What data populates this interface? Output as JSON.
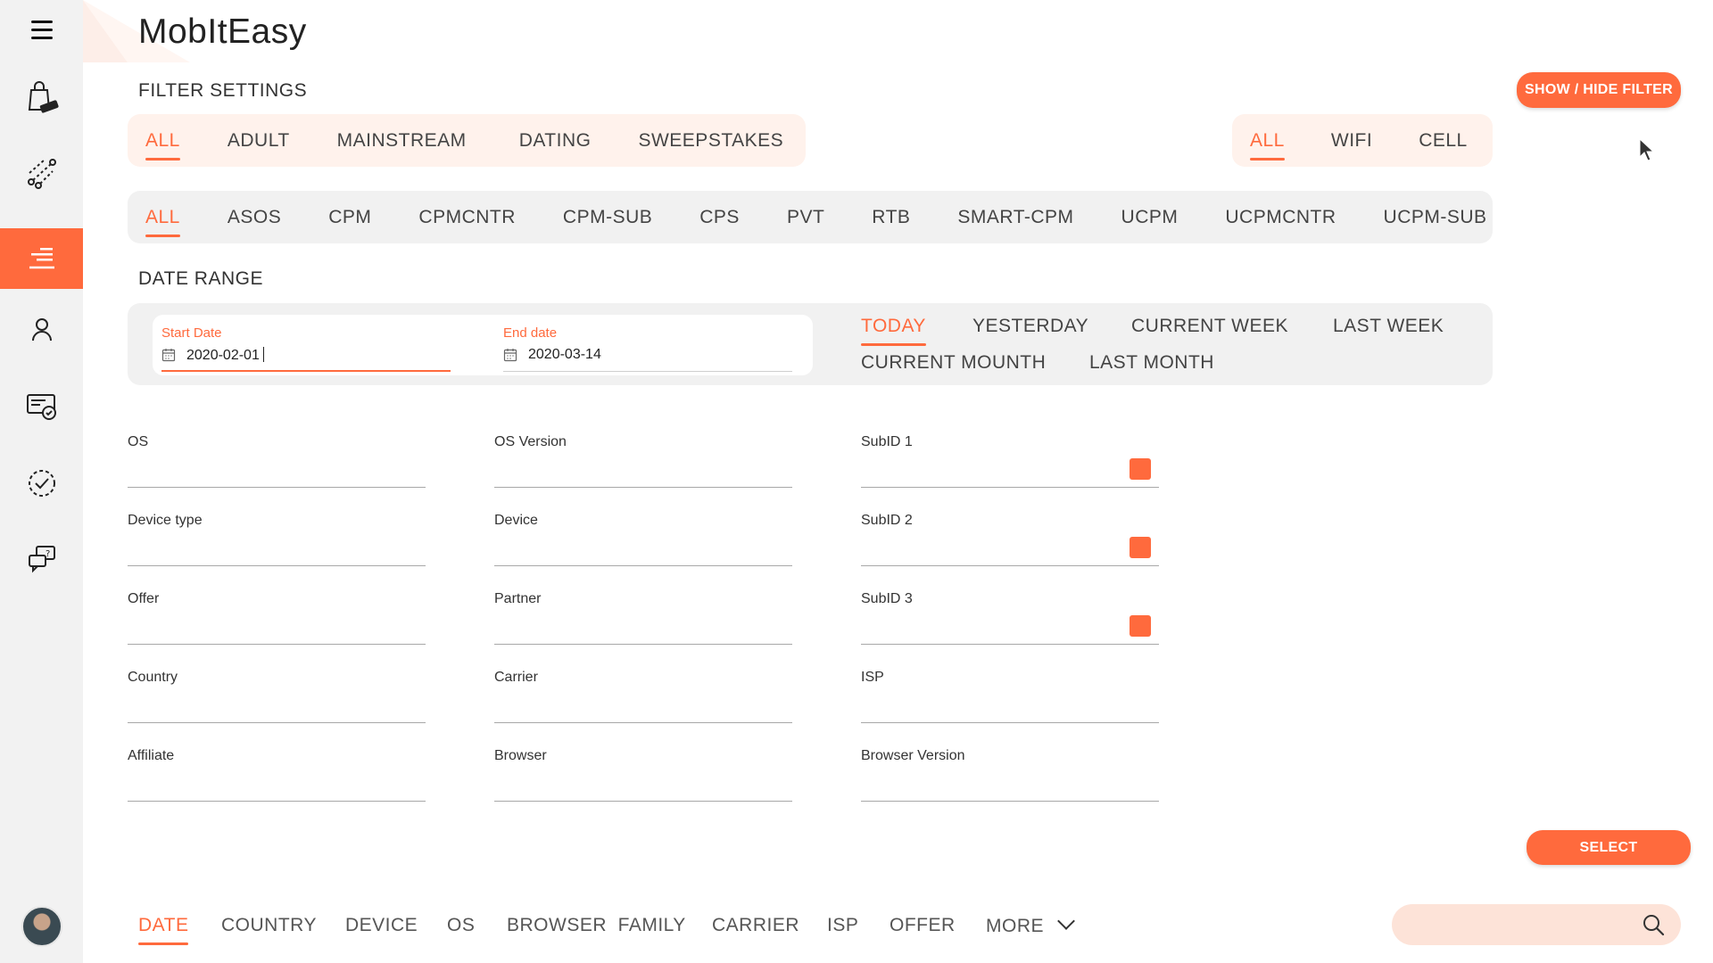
{
  "brand": "MobItEasy",
  "filter_settings_title": "FILTER SETTINGS",
  "show_hide_filter": "SHOW / HIDE FILTER",
  "categories": [
    "ALL",
    "ADULT",
    "MAINSTREAM",
    "DATING",
    "SWEEPSTAKES"
  ],
  "connection": [
    "ALL",
    "WIFI",
    "CELL"
  ],
  "pricing": [
    "ALL",
    "ASOS",
    "CPM",
    "CPMCNTR",
    "CPM-SUB",
    "CPS",
    "PVT",
    "RTB",
    "SMART-CPM",
    "UCPM",
    "UCPMCNTR",
    "UCPM-SUB"
  ],
  "date_range_title": "DATE RANGE",
  "start_date": {
    "label": "Start Date",
    "value": "2020-02-01"
  },
  "end_date": {
    "label": "End date",
    "value": "2020-03-14"
  },
  "ranges": [
    "TODAY",
    "YESTERDAY",
    "CURRENT WEEK",
    "LAST WEEK",
    "CURRENT MOUNTH",
    "LAST MONTH"
  ],
  "fields": {
    "os": "OS",
    "os_version": "OS Version",
    "subid1": "SubID 1",
    "device_type": "Device type",
    "device": "Device",
    "subid2": "SubID 2",
    "offer": "Offer",
    "partner": "Partner",
    "subid3": "SubID 3",
    "country": "Country",
    "carrier": "Carrier",
    "isp": "ISP",
    "affiliate": "Affiliate",
    "browser": "Browser",
    "browser_version": "Browser Version"
  },
  "select_label": "SELECT",
  "tabs": [
    "DATE",
    "COUNTRY",
    "DEVICE",
    "OS",
    "BROWSER  FAMILY",
    "CARRIER",
    "ISP",
    "OFFER",
    "MORE"
  ],
  "search": {
    "placeholder": ""
  },
  "sidebar_icons": [
    "hamburger-icon",
    "offer-bag-icon",
    "network-icon",
    "reports-icon",
    "user-icon",
    "billing-icon",
    "check-icon",
    "support-chat-icon"
  ],
  "colors": {
    "accent": "#ff6a3d",
    "peach": "#fff2ec",
    "panel_grey": "#f1f1f1",
    "sidebar": "#f2f2f2"
  }
}
